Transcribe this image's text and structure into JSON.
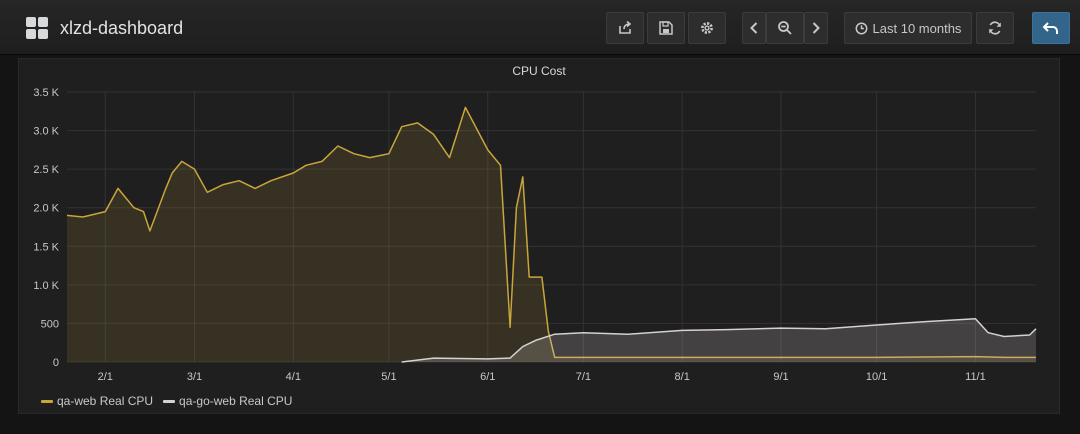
{
  "navbar": {
    "title": "xlzd-dashboard",
    "time_range_label": "Last 10 months",
    "icons": [
      "apps-icon",
      "share-icon",
      "save-icon",
      "settings-icon",
      "zoom-back-icon",
      "zoom-out-icon",
      "zoom-forward-icon",
      "clock-icon",
      "refresh-icon",
      "back-arrow-icon"
    ]
  },
  "panel": {
    "title": "CPU Cost"
  },
  "colors": {
    "series_1": "#c8a63c",
    "series_2": "#d6cfd4",
    "grid": "#333333",
    "text": "#c8c8c8"
  },
  "chart_data": {
    "type": "area",
    "title": "CPU Cost",
    "xlabel": "",
    "ylabel": "",
    "x_ticks": [
      "2/1",
      "3/1",
      "4/1",
      "5/1",
      "6/1",
      "7/1",
      "8/1",
      "9/1",
      "10/1",
      "11/1"
    ],
    "y_ticks": [
      "0",
      "500",
      "1.0 K",
      "1.5 K",
      "2.0 K",
      "2.5 K",
      "3.0 K",
      "3.5 K"
    ],
    "ylim": [
      0,
      3500
    ],
    "xlim": [
      "2018-01-20",
      "2018-11-20"
    ],
    "grid": true,
    "legend_position": "bottom-left",
    "series": [
      {
        "name": "qa-web Real CPU",
        "color": "#c8a63c",
        "x": [
          "2018-01-20",
          "2018-01-25",
          "2018-02-01",
          "2018-02-05",
          "2018-02-10",
          "2018-02-13",
          "2018-02-15",
          "2018-02-20",
          "2018-02-22",
          "2018-02-25",
          "2018-03-01",
          "2018-03-05",
          "2018-03-10",
          "2018-03-15",
          "2018-03-20",
          "2018-03-25",
          "2018-04-01",
          "2018-04-05",
          "2018-04-10",
          "2018-04-15",
          "2018-04-20",
          "2018-04-25",
          "2018-05-01",
          "2018-05-05",
          "2018-05-10",
          "2018-05-15",
          "2018-05-20",
          "2018-05-25",
          "2018-06-01",
          "2018-06-05",
          "2018-06-08",
          "2018-06-10",
          "2018-06-12",
          "2018-06-14",
          "2018-06-18",
          "2018-06-20",
          "2018-06-22",
          "2018-07-01",
          "2018-08-01",
          "2018-09-01",
          "2018-10-01",
          "2018-11-01",
          "2018-11-10",
          "2018-11-20"
        ],
        "values": [
          1900,
          1880,
          1950,
          2250,
          2000,
          1950,
          1700,
          2250,
          2450,
          2600,
          2500,
          2200,
          2300,
          2350,
          2250,
          2350,
          2450,
          2550,
          2600,
          2800,
          2700,
          2650,
          2700,
          3050,
          3100,
          2950,
          2650,
          3300,
          2750,
          2550,
          450,
          2000,
          2400,
          1100,
          1100,
          400,
          60,
          60,
          60,
          60,
          60,
          70,
          60,
          60
        ]
      },
      {
        "name": "qa-go-web Real CPU",
        "color": "#d6cfd4",
        "x": [
          "2018-05-05",
          "2018-05-15",
          "2018-06-01",
          "2018-06-08",
          "2018-06-12",
          "2018-06-16",
          "2018-06-22",
          "2018-07-01",
          "2018-07-15",
          "2018-08-01",
          "2018-08-15",
          "2018-09-01",
          "2018-09-15",
          "2018-10-01",
          "2018-10-15",
          "2018-11-01",
          "2018-11-05",
          "2018-11-10",
          "2018-11-18",
          "2018-11-20"
        ],
        "values": [
          0,
          50,
          40,
          50,
          200,
          280,
          360,
          380,
          360,
          410,
          420,
          440,
          430,
          480,
          520,
          560,
          380,
          330,
          350,
          430
        ]
      }
    ]
  }
}
